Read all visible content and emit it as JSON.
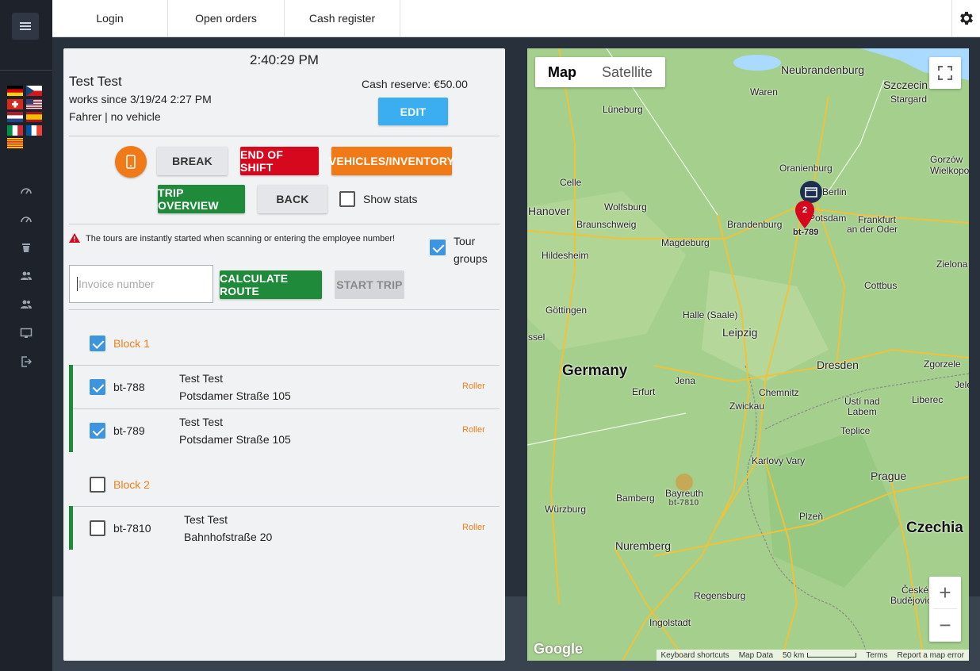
{
  "nav": {
    "tabs": [
      {
        "label": "Login"
      },
      {
        "label": "Open orders"
      },
      {
        "label": "Cash register"
      }
    ]
  },
  "sidebar": {
    "flags": [
      "de",
      "cz",
      "ch",
      "us",
      "nl",
      "es",
      "it",
      "fr",
      "ca"
    ],
    "icons": [
      "speedometer-icon",
      "speedometer-icon",
      "trash-bin-icon",
      "users-icon",
      "users-icon",
      "monitor-icon",
      "logout-icon"
    ]
  },
  "header": {
    "clock": "2:40:29 PM",
    "driver_name": "Test Test",
    "works_since": "works since 3/19/24 2:27 PM",
    "role": "Fahrer | no vehicle",
    "cash_reserve": "Cash reserve: €50.00",
    "edit_label": "EDIT"
  },
  "actions": {
    "break_label": "BREAK",
    "end_of_shift_label": "END OF SHIFT",
    "vehicles_label": "VEHICLES/INVENTORY",
    "trip_overview_label": "TRIP OVERVIEW",
    "back_label": "BACK",
    "show_stats_label": "Show stats",
    "show_stats_checked": false
  },
  "scan": {
    "warning": "The tours are instantly started when scanning or entering the employee number!",
    "tour_groups_label_1": "Tour",
    "tour_groups_label_2": "groups",
    "tour_groups_checked": true,
    "invoice_placeholder": "Invoice number",
    "calculate_label": "CALCULATE ROUTE",
    "start_trip_label": "START TRIP"
  },
  "blocks": [
    {
      "label": "Block 1",
      "checked": true,
      "tours": [
        {
          "id": "bt-788",
          "name": "Test Test",
          "address": "Potsdamer Straße 105",
          "type": "Roller",
          "checked": true
        },
        {
          "id": "bt-789",
          "name": "Test Test",
          "address": "Potsdamer Straße 105",
          "type": "Roller",
          "checked": true
        }
      ]
    },
    {
      "label": "Block 2",
      "checked": false,
      "tours": [
        {
          "id": "bt-7810",
          "name": "Test Test",
          "address": "Bahnhofstraße 20",
          "type": "Roller",
          "checked": false
        }
      ]
    }
  ],
  "map": {
    "type_map": "Map",
    "type_satellite": "Satellite",
    "zoom_in": "+",
    "zoom_out": "−",
    "google": "Google",
    "attribution": {
      "shortcuts": "Keyboard shortcuts",
      "data": "Map Data",
      "scale": "50 km",
      "terms": "Terms",
      "report": "Report a map error"
    },
    "cluster_count": "2",
    "marker_1": "bt-789",
    "marker_2": "bt-7810",
    "labels": {
      "germany": "Germany",
      "czechia": "Czechia",
      "szczecin": "Szczecin",
      "stargard": "Stargard",
      "neubrandenburg": "Neubrandenburg",
      "waren": "Waren",
      "luneburg": "Lüneburg",
      "oranienburg": "Oranienburg",
      "gorzow": "Gorzów",
      "wielkopolski": "Wielkopols",
      "hanover": "Hanover",
      "wolfsburg": "Wolfsburg",
      "celle": "Celle",
      "braunschweig": "Braunschweig",
      "brandenburg": "Brandenburg",
      "potsdam": "Potsdam",
      "berlin": "Berlin",
      "frankfurt_oder": "Frankfurt",
      "an_der_oder": "an der Oder",
      "magdeburg": "Magdeburg",
      "hildesheim": "Hildesheim",
      "zielona": "Zielona",
      "cottbus": "Cottbus",
      "gottingen": "Göttingen",
      "halle": "Halle (Saale)",
      "leipzig": "Leipzig",
      "kassel": "ssel",
      "dresden": "Dresden",
      "zgorzele": "Zgorzele",
      "erfurt": "Erfurt",
      "jena": "Jena",
      "chemnitz": "Chemnitz",
      "usti1": "Ústí nad",
      "usti2": "Labem",
      "jel": "Jele",
      "liberec": "Liberec",
      "zwickau": "Zwickau",
      "teplice": "Teplice",
      "karlovy": "Karlovy Vary",
      "prague": "Prague",
      "bayreuth": "Bayreuth",
      "bamberg": "Bamberg",
      "wurzburg": "Würzburg",
      "plzen": "Plzeň",
      "nuremberg": "Nuremberg",
      "regensburg": "Regensburg",
      "ingolstadt": "Ingolstadt",
      "ceske1": "České",
      "ceske2": "Budějovice"
    }
  }
}
